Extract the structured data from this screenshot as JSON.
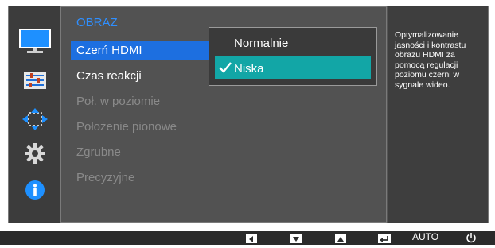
{
  "menu": {
    "section_title": "OBRAZ",
    "items": [
      {
        "label": "Czerń HDMI",
        "enabled": true,
        "selected": true
      },
      {
        "label": "Czas reakcji",
        "enabled": true,
        "selected": false
      },
      {
        "label": "Poł. w poziomie",
        "enabled": false,
        "selected": false
      },
      {
        "label": "Położenie pionowe",
        "enabled": false,
        "selected": false
      },
      {
        "label": "Zgrubne",
        "enabled": false,
        "selected": false
      },
      {
        "label": "Precyzyjne",
        "enabled": false,
        "selected": false
      }
    ]
  },
  "submenu": {
    "options": [
      {
        "label": "Normalnie",
        "selected": false
      },
      {
        "label": "Niska",
        "selected": true
      }
    ]
  },
  "description": "Optymalizowanie jasności i kontrastu obrazu HDMI za pomocą regulacji poziomu czerni w sygnale wideo.",
  "sidebar_icons": [
    "monitor-icon",
    "settings-list-icon",
    "resize-arrows-icon",
    "gear-icon",
    "info-icon"
  ],
  "bottom_bar": {
    "buttons": [
      "left-arrow",
      "down-arrow",
      "up-arrow",
      "enter-icon"
    ],
    "auto_label": "AUTO",
    "power_icon": "power-icon"
  },
  "colors": {
    "accent_blue": "#1d6fe0",
    "title_blue": "#2f8fff",
    "selected_teal": "#12a6a6"
  }
}
